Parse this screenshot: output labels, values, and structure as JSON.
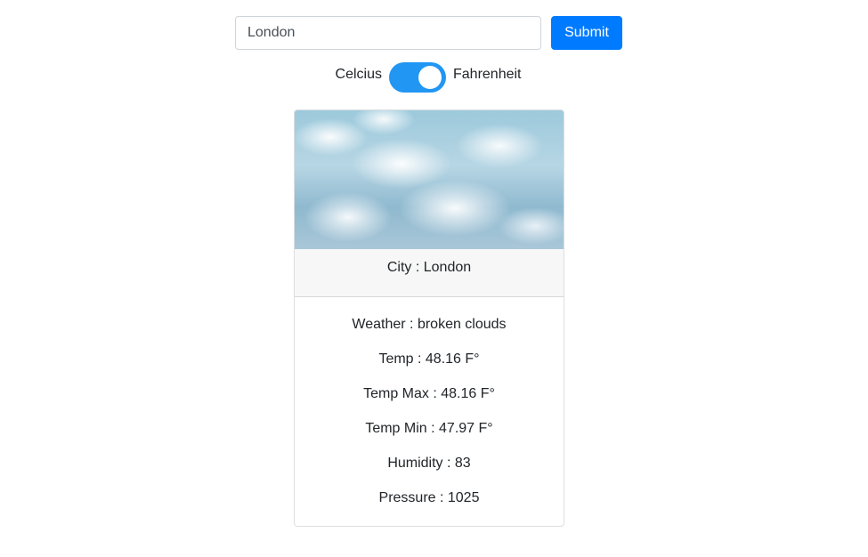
{
  "search": {
    "value": "London",
    "submit_label": "Submit"
  },
  "units": {
    "left_label": "Celcius",
    "right_label": "Fahrenheit",
    "selected": "Fahrenheit"
  },
  "card": {
    "city": "City : London",
    "weather": "Weather : broken clouds",
    "temp": "Temp : 48.16 F°",
    "temp_max": "Temp Max : 48.16 F°",
    "temp_min": "Temp Min : 47.97 F°",
    "humidity": "Humidity : 83",
    "pressure": "Pressure : 1025"
  },
  "colors": {
    "accent": "#007bff",
    "toggle_on": "#2196f3"
  }
}
